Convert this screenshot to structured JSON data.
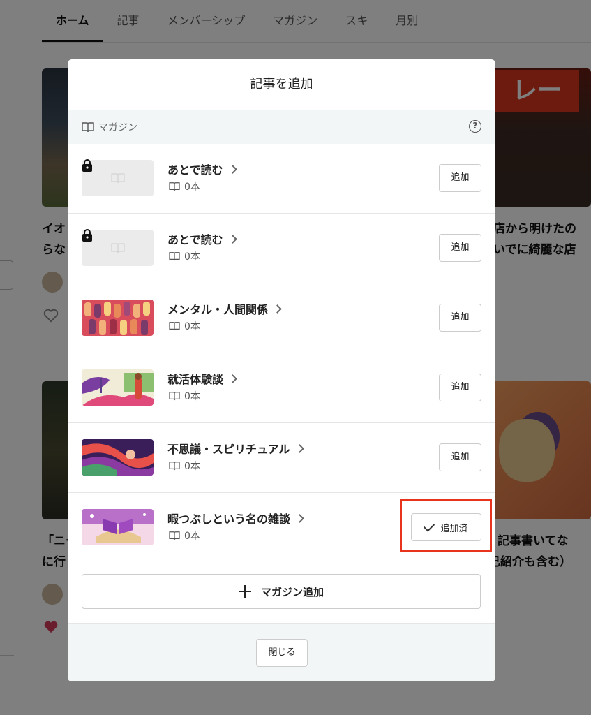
{
  "background": {
    "tabs": [
      "ホーム",
      "記事",
      "メンバーシップ",
      "マガジン",
      "スキ",
      "月別"
    ],
    "card_fragments": {
      "left_top_1": "イオ",
      "left_top_2": "らな",
      "right_top_1": "店から明けたの",
      "right_top_2": "いでに綺麗な店",
      "left_bottom_1": "「ニー",
      "left_bottom_2": "に行",
      "right_bottom_1": "記事書いてな",
      "right_bottom_2": "己紹介も含む）",
      "sign_text": "レー"
    }
  },
  "modal": {
    "title": "記事を追加",
    "section_label": "マガジン",
    "help_icon": "?",
    "magazines": [
      {
        "title": "あとで読む",
        "count": "0本",
        "button": "追加",
        "added": false,
        "locked": true
      },
      {
        "title": "あとで読む",
        "count": "0本",
        "button": "追加",
        "added": false,
        "locked": true
      },
      {
        "title": "メンタル・人間関係",
        "count": "0本",
        "button": "追加",
        "added": false,
        "locked": false
      },
      {
        "title": "就活体験談",
        "count": "0本",
        "button": "追加",
        "added": false,
        "locked": false
      },
      {
        "title": "不思議・スピリチュアル",
        "count": "0本",
        "button": "追加",
        "added": false,
        "locked": false
      },
      {
        "title": "暇つぶしという名の雑談",
        "count": "0本",
        "button": "追加済",
        "added": true,
        "locked": false
      }
    ],
    "add_magazine_label": "マガジン追加",
    "close_label": "閉じる"
  },
  "colors": {
    "highlight": "#e8341c",
    "section_bg": "#f3f6f7",
    "heart": "#d33a5a"
  },
  "icons": [
    "book-icon",
    "help-icon",
    "lock-icon",
    "chevron-right-icon",
    "check-icon",
    "plus-icon",
    "heart-icon"
  ]
}
